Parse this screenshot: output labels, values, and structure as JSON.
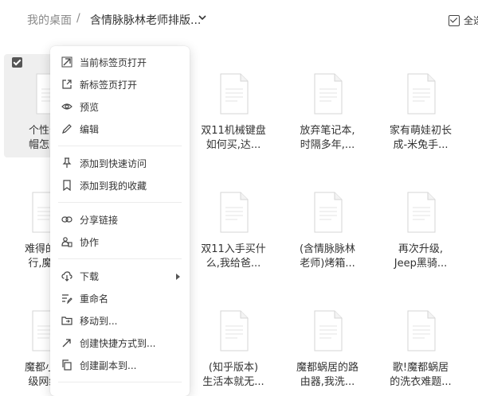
{
  "breadcrumb": {
    "root": "我的桌面",
    "separator": "/",
    "current": "含情脉脉林老师排版..."
  },
  "select_all_label": "全选",
  "files": [
    {
      "label": "个性化主\n帽怎么买",
      "selected": true
    },
    {
      "label": ""
    },
    {
      "label": "双11机械键盘\n如何买,达..."
    },
    {
      "label": "放弃笔记本,\n时隔多年,..."
    },
    {
      "label": "家有萌娃初长\n成-米兔手..."
    },
    {
      "label": "难得的短\n行,魔都"
    },
    {
      "label": ""
    },
    {
      "label": "双11入手买什\n么,我给爸..."
    },
    {
      "label": "(含情脉脉林\n老师)烤箱..."
    },
    {
      "label": "再次升级,\nJeep黑骑..."
    },
    {
      "label": "魔都小户\n级网络,"
    },
    {
      "label": ""
    },
    {
      "label": "(知乎版本)\n生活本就无..."
    },
    {
      "label": "魔都蜗居的路\n由器,我洗..."
    },
    {
      "label": "歌!魔都蜗居\n的洗衣难题..."
    }
  ],
  "context_menu": {
    "items": [
      {
        "label": "当前标签页打开",
        "icon": "open-in-current-tab-icon"
      },
      {
        "label": "新标签页打开",
        "icon": "open-in-new-tab-icon"
      },
      {
        "label": "预览",
        "icon": "eye-icon"
      },
      {
        "label": "编辑",
        "icon": "pencil-icon"
      },
      {
        "label": "添加到快速访问",
        "icon": "pin-icon"
      },
      {
        "label": "添加到我的收藏",
        "icon": "bookmark-icon"
      },
      {
        "label": "分享链接",
        "icon": "link-icon"
      },
      {
        "label": "协作",
        "icon": "collaborate-icon"
      },
      {
        "label": "下载",
        "icon": "cloud-download-icon"
      },
      {
        "label": "重命名",
        "icon": "rename-icon"
      },
      {
        "label": "移动到...",
        "icon": "folder-move-icon"
      },
      {
        "label": "创建快捷方式到...",
        "icon": "shortcut-icon"
      },
      {
        "label": "创建副本到...",
        "icon": "copy-icon"
      }
    ]
  }
}
